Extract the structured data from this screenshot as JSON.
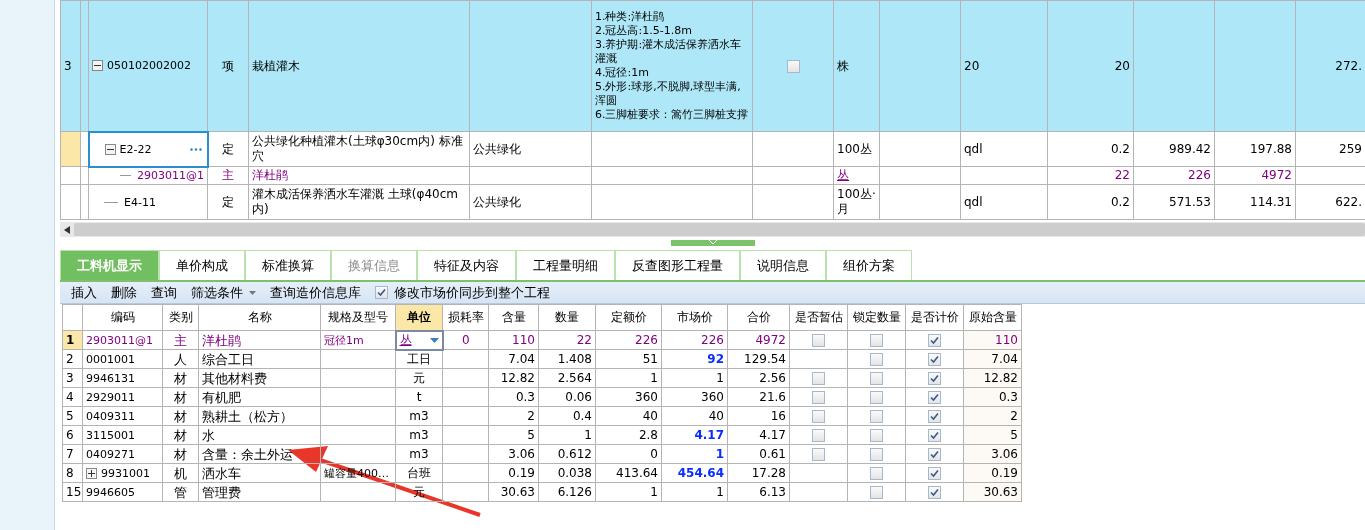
{
  "top_grid": {
    "rows": [
      {
        "row_no": "3",
        "code": "050102002002",
        "expanded": true,
        "category": "项",
        "name": "栽植灌木",
        "features": [
          "1.种类:洋杜鹃",
          "2.冠丛高:1.5-1.8m",
          "3.养护期:灌木成活保养洒水车灌溉",
          "4.冠径:1m",
          "5.外形:球形,不脱脚,球型丰满,浑圆",
          "6.三脚桩要求：篙竹三脚桩支撑"
        ],
        "checked": false,
        "unit": "株",
        "column_10": "20",
        "column_11": "20",
        "column_14": "272.",
        "selected": false,
        "kind": "item",
        "children": [
          {
            "code": "E2-22",
            "expanded": true,
            "category": "定",
            "name": "公共绿化种植灌木(土球φ30cm内) 标准穴",
            "specialty": "公共绿化",
            "unit": "100丛",
            "column_10": "qdl",
            "column_11": "0.2",
            "column_12": "989.42",
            "column_13": "197.88",
            "column_14": "259",
            "selected": true,
            "kind": "quota",
            "children": [
              {
                "code": "2903011@1",
                "category": "主",
                "name": "洋杜鹃",
                "unit": "丛",
                "column_11": "22",
                "column_12": "226",
                "column_13": "4972",
                "selected": false,
                "kind": "material"
              }
            ]
          },
          {
            "code": "E4-11",
            "category": "定",
            "name": "灌木成活保养洒水车灌溉 土球(φ40cm内)",
            "specialty": "公共绿化",
            "unit": "100丛·月",
            "column_10": "qdl",
            "column_11": "0.2",
            "column_12": "571.53",
            "column_13": "114.31",
            "column_14": "622.",
            "selected": false,
            "kind": "quota"
          }
        ]
      }
    ]
  },
  "tabs": [
    {
      "label": "工料机显示",
      "selected": true,
      "disabled": false
    },
    {
      "label": "单价构成",
      "selected": false,
      "disabled": false
    },
    {
      "label": "标准换算",
      "selected": false,
      "disabled": false
    },
    {
      "label": "换算信息",
      "selected": false,
      "disabled": true
    },
    {
      "label": "特征及内容",
      "selected": false,
      "disabled": false
    },
    {
      "label": "工程量明细",
      "selected": false,
      "disabled": false
    },
    {
      "label": "反查图形工程量",
      "selected": false,
      "disabled": false
    },
    {
      "label": "说明信息",
      "selected": false,
      "disabled": false
    },
    {
      "label": "组价方案",
      "selected": false,
      "disabled": false
    }
  ],
  "toolbar": [
    {
      "kind": "button",
      "label": "插入"
    },
    {
      "kind": "button",
      "label": "删除"
    },
    {
      "kind": "button",
      "label": "查询"
    },
    {
      "kind": "dropdown",
      "label": "筛选条件"
    },
    {
      "kind": "button",
      "label": "查询造价信息库"
    },
    {
      "kind": "checkbox",
      "label": "修改市场价同步到整个工程",
      "checked": true
    }
  ],
  "resource_table": {
    "columns": [
      {
        "label": "编码",
        "selected": false
      },
      {
        "label": "类别",
        "selected": false
      },
      {
        "label": "名称",
        "selected": false
      },
      {
        "label": "规格及型号",
        "selected": false
      },
      {
        "label": "单位",
        "selected": true
      },
      {
        "label": "损耗率",
        "selected": false
      },
      {
        "label": "含量",
        "selected": false
      },
      {
        "label": "数量",
        "selected": false
      },
      {
        "label": "定额价",
        "selected": false
      },
      {
        "label": "市场价",
        "selected": false
      },
      {
        "label": "合价",
        "selected": false
      },
      {
        "label": "是否暂估",
        "selected": false
      },
      {
        "label": "锁定数量",
        "selected": false
      },
      {
        "label": "是否计价",
        "selected": false
      },
      {
        "label": "原始含量",
        "selected": false
      }
    ],
    "rows": [
      {
        "no": "1",
        "code": "2903011@1",
        "category": "主",
        "name": "洋杜鹃",
        "spec": "冠径1m",
        "unit": "丛",
        "loss": "0",
        "content": "110",
        "quantity": "22",
        "quota_price": "226",
        "market_price": "226",
        "modified": false,
        "total": "4972",
        "provisional": false,
        "locked": false,
        "priced": true,
        "original": "110",
        "kind": "main",
        "selected": true
      },
      {
        "no": "2",
        "code": "0001001",
        "category": "人",
        "name": "综合工日",
        "unit": "工日",
        "content": "7.04",
        "quantity": "1.408",
        "quota_price": "51",
        "market_price": "92",
        "modified": true,
        "total": "129.54",
        "locked": false,
        "priced": true,
        "original": "7.04",
        "kind": "normal",
        "selected": false
      },
      {
        "no": "3",
        "code": "9946131",
        "category": "材",
        "name": "其他材料费",
        "unit": "元",
        "content": "12.82",
        "quantity": "2.564",
        "quota_price": "1",
        "market_price": "1",
        "modified": false,
        "total": "2.56",
        "provisional": false,
        "locked": false,
        "priced": true,
        "original": "12.82",
        "kind": "normal",
        "selected": false
      },
      {
        "no": "4",
        "code": "2929011",
        "category": "材",
        "name": "有机肥",
        "unit": "t",
        "content": "0.3",
        "quantity": "0.06",
        "quota_price": "360",
        "market_price": "360",
        "modified": false,
        "total": "21.6",
        "provisional": false,
        "locked": false,
        "priced": true,
        "original": "0.3",
        "kind": "normal",
        "selected": false
      },
      {
        "no": "5",
        "code": "0409311",
        "category": "材",
        "name": "熟耕土（松方）",
        "unit": "m3",
        "content": "2",
        "quantity": "0.4",
        "quota_price": "40",
        "market_price": "40",
        "modified": false,
        "total": "16",
        "provisional": false,
        "locked": false,
        "priced": true,
        "original": "2",
        "kind": "normal",
        "selected": false
      },
      {
        "no": "6",
        "code": "3115001",
        "category": "材",
        "name": "水",
        "unit": "m3",
        "content": "5",
        "quantity": "1",
        "quota_price": "2.8",
        "market_price": "4.17",
        "modified": true,
        "total": "4.17",
        "provisional": false,
        "locked": false,
        "priced": true,
        "original": "5",
        "kind": "normal",
        "selected": false
      },
      {
        "no": "7",
        "code": "0409271",
        "category": "材",
        "name": "含量：余土外运",
        "unit": "m3",
        "content": "3.06",
        "quantity": "0.612",
        "quota_price": "0",
        "market_price": "1",
        "modified": true,
        "total": "0.61",
        "provisional": false,
        "locked": false,
        "priced": true,
        "original": "3.06",
        "kind": "normal",
        "selected": false
      },
      {
        "no": "8",
        "code": "9931001",
        "expanded": false,
        "category": "机",
        "name": "洒水车",
        "spec": "罐容量400…",
        "unit": "台班",
        "content": "0.19",
        "quantity": "0.038",
        "quota_price": "413.64",
        "market_price": "454.64",
        "modified": true,
        "total": "17.28",
        "locked": false,
        "priced": true,
        "original": "0.19",
        "kind": "normal",
        "selected": false
      },
      {
        "no": "15",
        "code": "9946605",
        "category": "管",
        "name": "管理费",
        "unit": "元",
        "content": "30.63",
        "quantity": "6.126",
        "quota_price": "1",
        "market_price": "1",
        "modified": false,
        "total": "6.13",
        "locked": false,
        "priced": true,
        "original": "30.63",
        "kind": "normal",
        "selected": false
      }
    ]
  }
}
